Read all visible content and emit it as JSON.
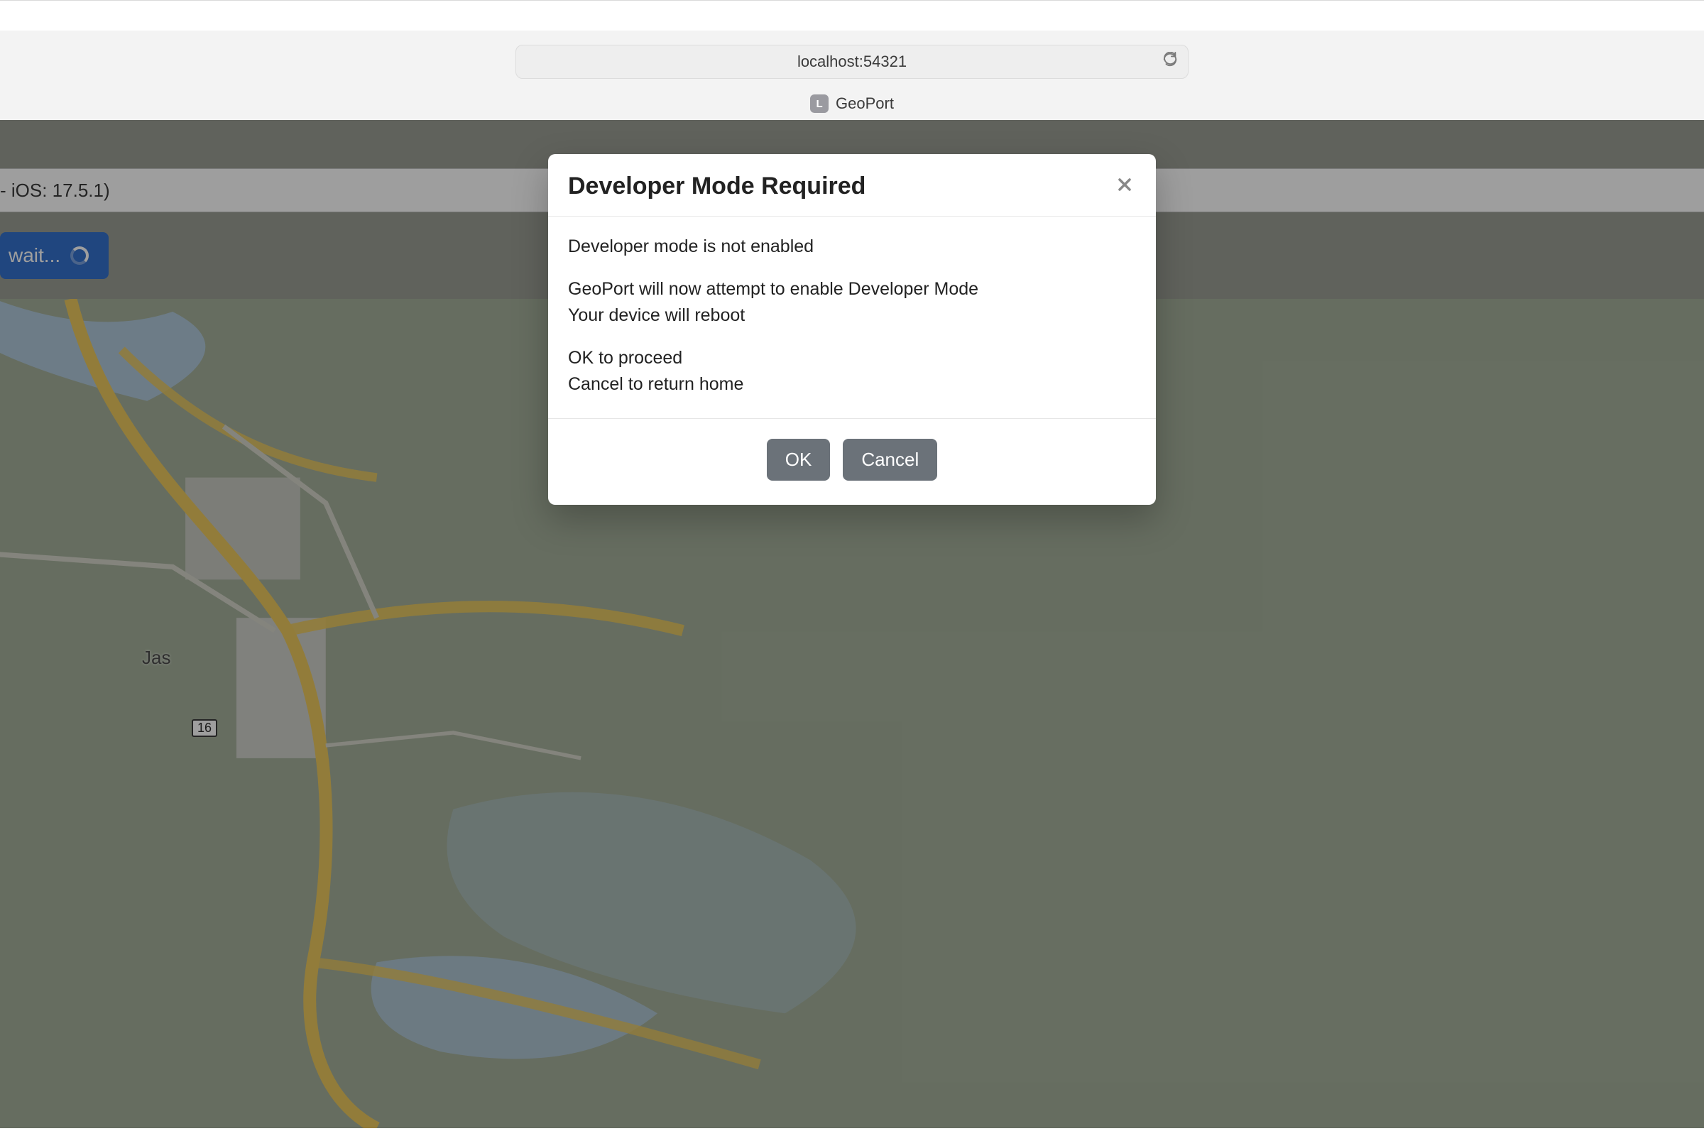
{
  "browser": {
    "address": "localhost:54321",
    "tab_favicon_letter": "L",
    "tab_title": "GeoPort"
  },
  "page": {
    "device_info": " - iOS: 17.5.1)",
    "wait_label": "wait...",
    "map_city_label": "Jas",
    "route_number": "16"
  },
  "modal": {
    "title": "Developer Mode Required",
    "line1": "Developer mode is not enabled",
    "line2": "GeoPort will now attempt to enable Developer Mode",
    "line3": "Your device will reboot",
    "line4": "OK to proceed",
    "line5": "Cancel to return home",
    "ok_label": "OK",
    "cancel_label": "Cancel"
  }
}
